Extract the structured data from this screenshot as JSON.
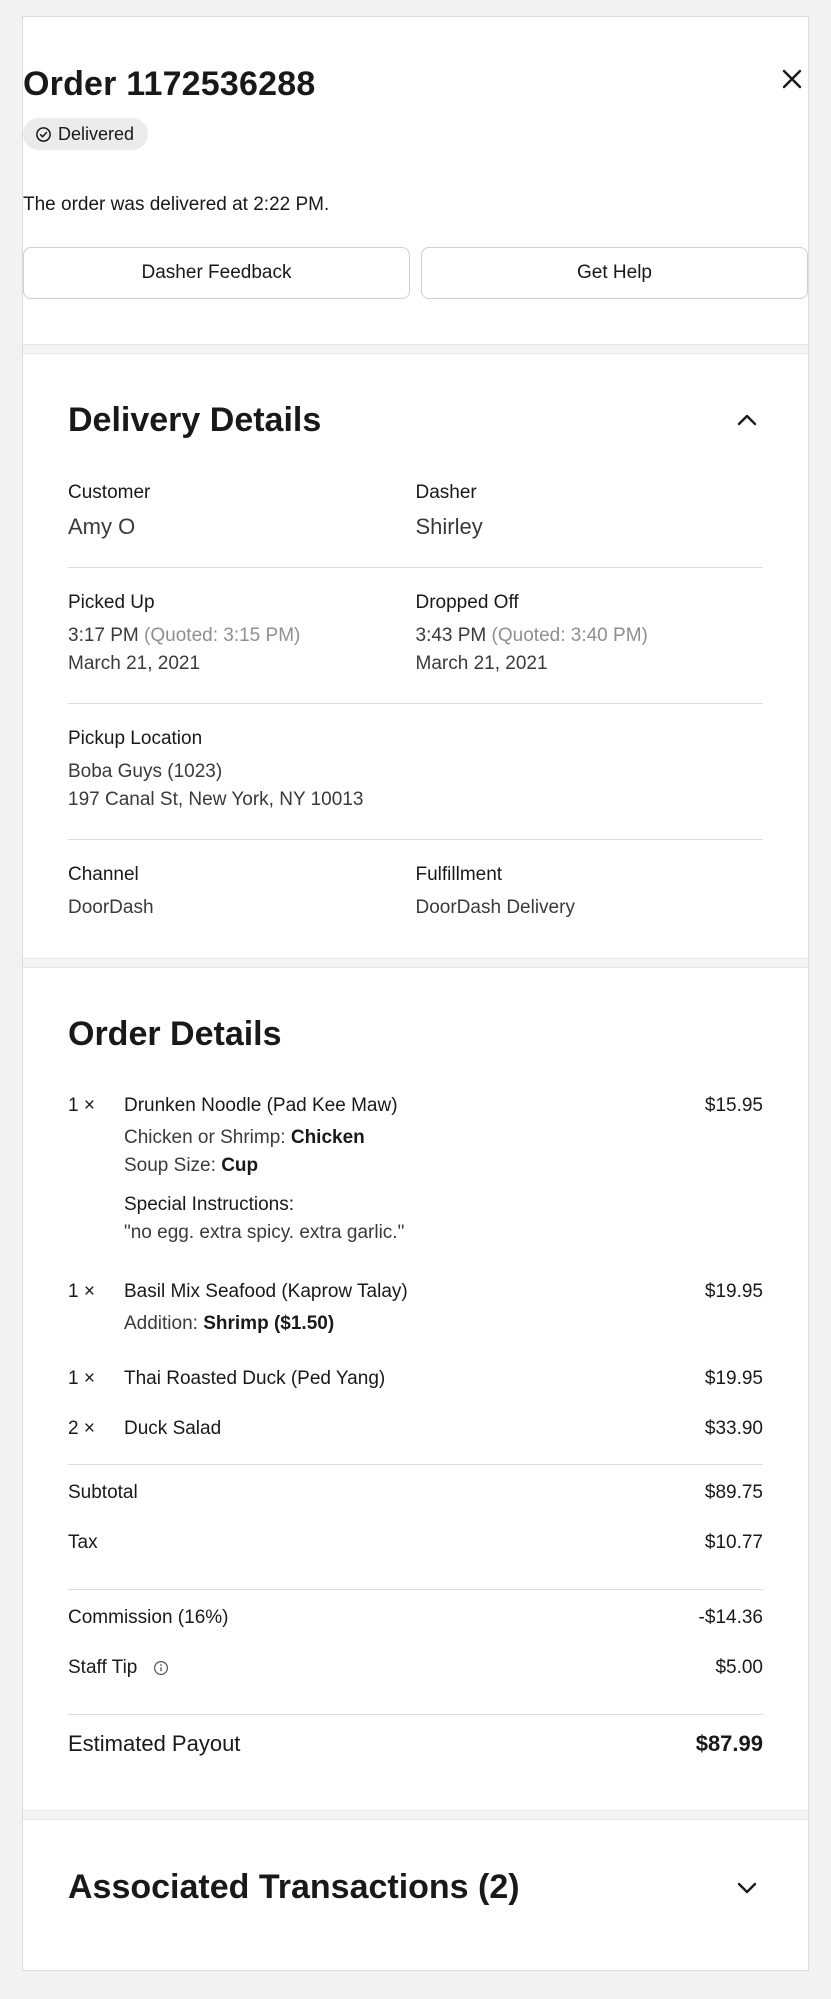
{
  "header": {
    "title": "Order 1172536288",
    "status_badge": "Delivered",
    "status_text": "The order was delivered at 2:22 PM.",
    "buttons": [
      "Dasher Feedback",
      "Get Help"
    ]
  },
  "delivery": {
    "title": "Delivery Details",
    "customer_label": "Customer",
    "customer": "Amy O",
    "dasher_label": "Dasher",
    "dasher": "Shirley",
    "picked_label": "Picked Up",
    "picked_time": "3:17 PM",
    "picked_quoted": "(Quoted: 3:15 PM)",
    "picked_date": "March 21, 2021",
    "dropped_label": "Dropped Off",
    "dropped_time": "3:43 PM",
    "dropped_quoted": "(Quoted: 3:40 PM)",
    "dropped_date": "March 21, 2021",
    "pickup_label": "Pickup Location",
    "pickup_name": "Boba Guys (1023)",
    "pickup_address": "197 Canal St, New York, NY 10013",
    "channel_label": "Channel",
    "channel": "DoorDash",
    "fulfillment_label": "Fulfillment",
    "fulfillment": "DoorDash Delivery"
  },
  "order": {
    "title": "Order Details",
    "items": [
      {
        "qty": "1 ×",
        "name": "Drunken Noodle (Pad Kee Maw)",
        "price": "$15.95",
        "opt1_label": "Chicken or Shrimp:",
        "opt1_value": "Chicken",
        "opt2_label": "Soup Size:",
        "opt2_value": "Cup",
        "instructions_label": "Special Instructions:",
        "instructions": "\"no egg. extra spicy. extra garlic.\""
      },
      {
        "qty": "1 ×",
        "name": "Basil Mix Seafood (Kaprow Talay)",
        "price": "$19.95",
        "opt1_label": "Addition:",
        "opt1_value": "Shrimp ($1.50)"
      },
      {
        "qty": "1 ×",
        "name": "Thai Roasted Duck (Ped Yang)",
        "price": "$19.95"
      },
      {
        "qty": "2 ×",
        "name": "Duck Salad",
        "price": "$33.90"
      }
    ],
    "subtotal_label": "Subtotal",
    "subtotal": "$89.75",
    "tax_label": "Tax",
    "tax": "$10.77",
    "commission_label": "Commission (16%)",
    "commission": "-$14.36",
    "tip_label": "Staff Tip",
    "tip": "$5.00",
    "payout_label": "Estimated Payout",
    "payout": "$87.99"
  },
  "associated": {
    "title": "Associated Transactions (2)"
  },
  "icons": {
    "close": "close-icon",
    "status": "check-circle-icon",
    "collapse": "chevron-up-icon",
    "expand": "chevron-down-icon",
    "info": "info-icon"
  }
}
